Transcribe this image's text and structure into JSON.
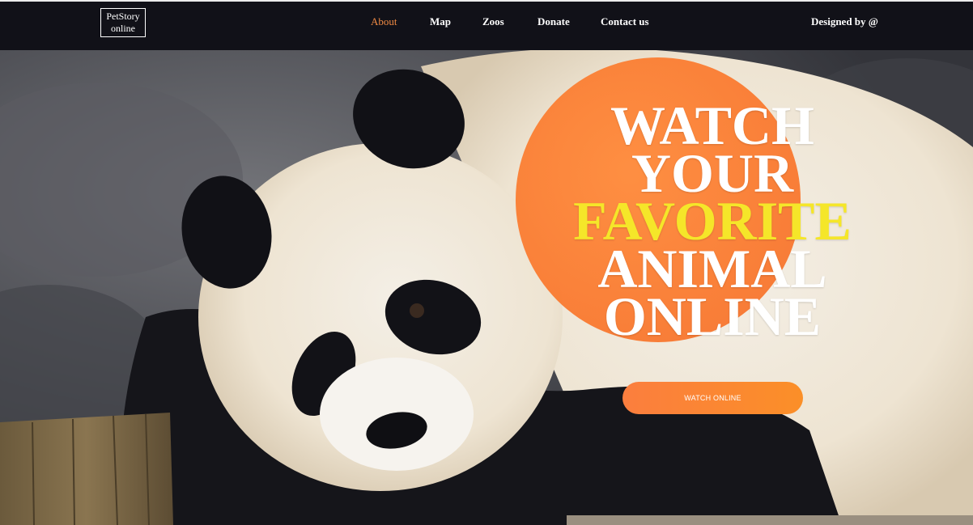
{
  "header": {
    "logo_line1": "PetStory",
    "logo_line2": "online",
    "nav": [
      {
        "label": "About",
        "active": true
      },
      {
        "label": "Map",
        "active": false
      },
      {
        "label": "Zoos",
        "active": false
      },
      {
        "label": "Donate",
        "active": false
      },
      {
        "label": "Contact us",
        "active": false
      }
    ],
    "credit": "Designed by @"
  },
  "hero": {
    "image": "giant-panda-photo",
    "headline": [
      "WATCH",
      "YOUR",
      "FAVORITE",
      "ANIMAL",
      "ONLINE"
    ],
    "highlight_word": "FAVORITE",
    "cta_label": "WATCH ONLINE"
  },
  "colors": {
    "header_bg": "#111118",
    "nav_active": "#f08a43",
    "accent_orange": "#f9782f",
    "highlight_yellow": "#f5e629"
  }
}
